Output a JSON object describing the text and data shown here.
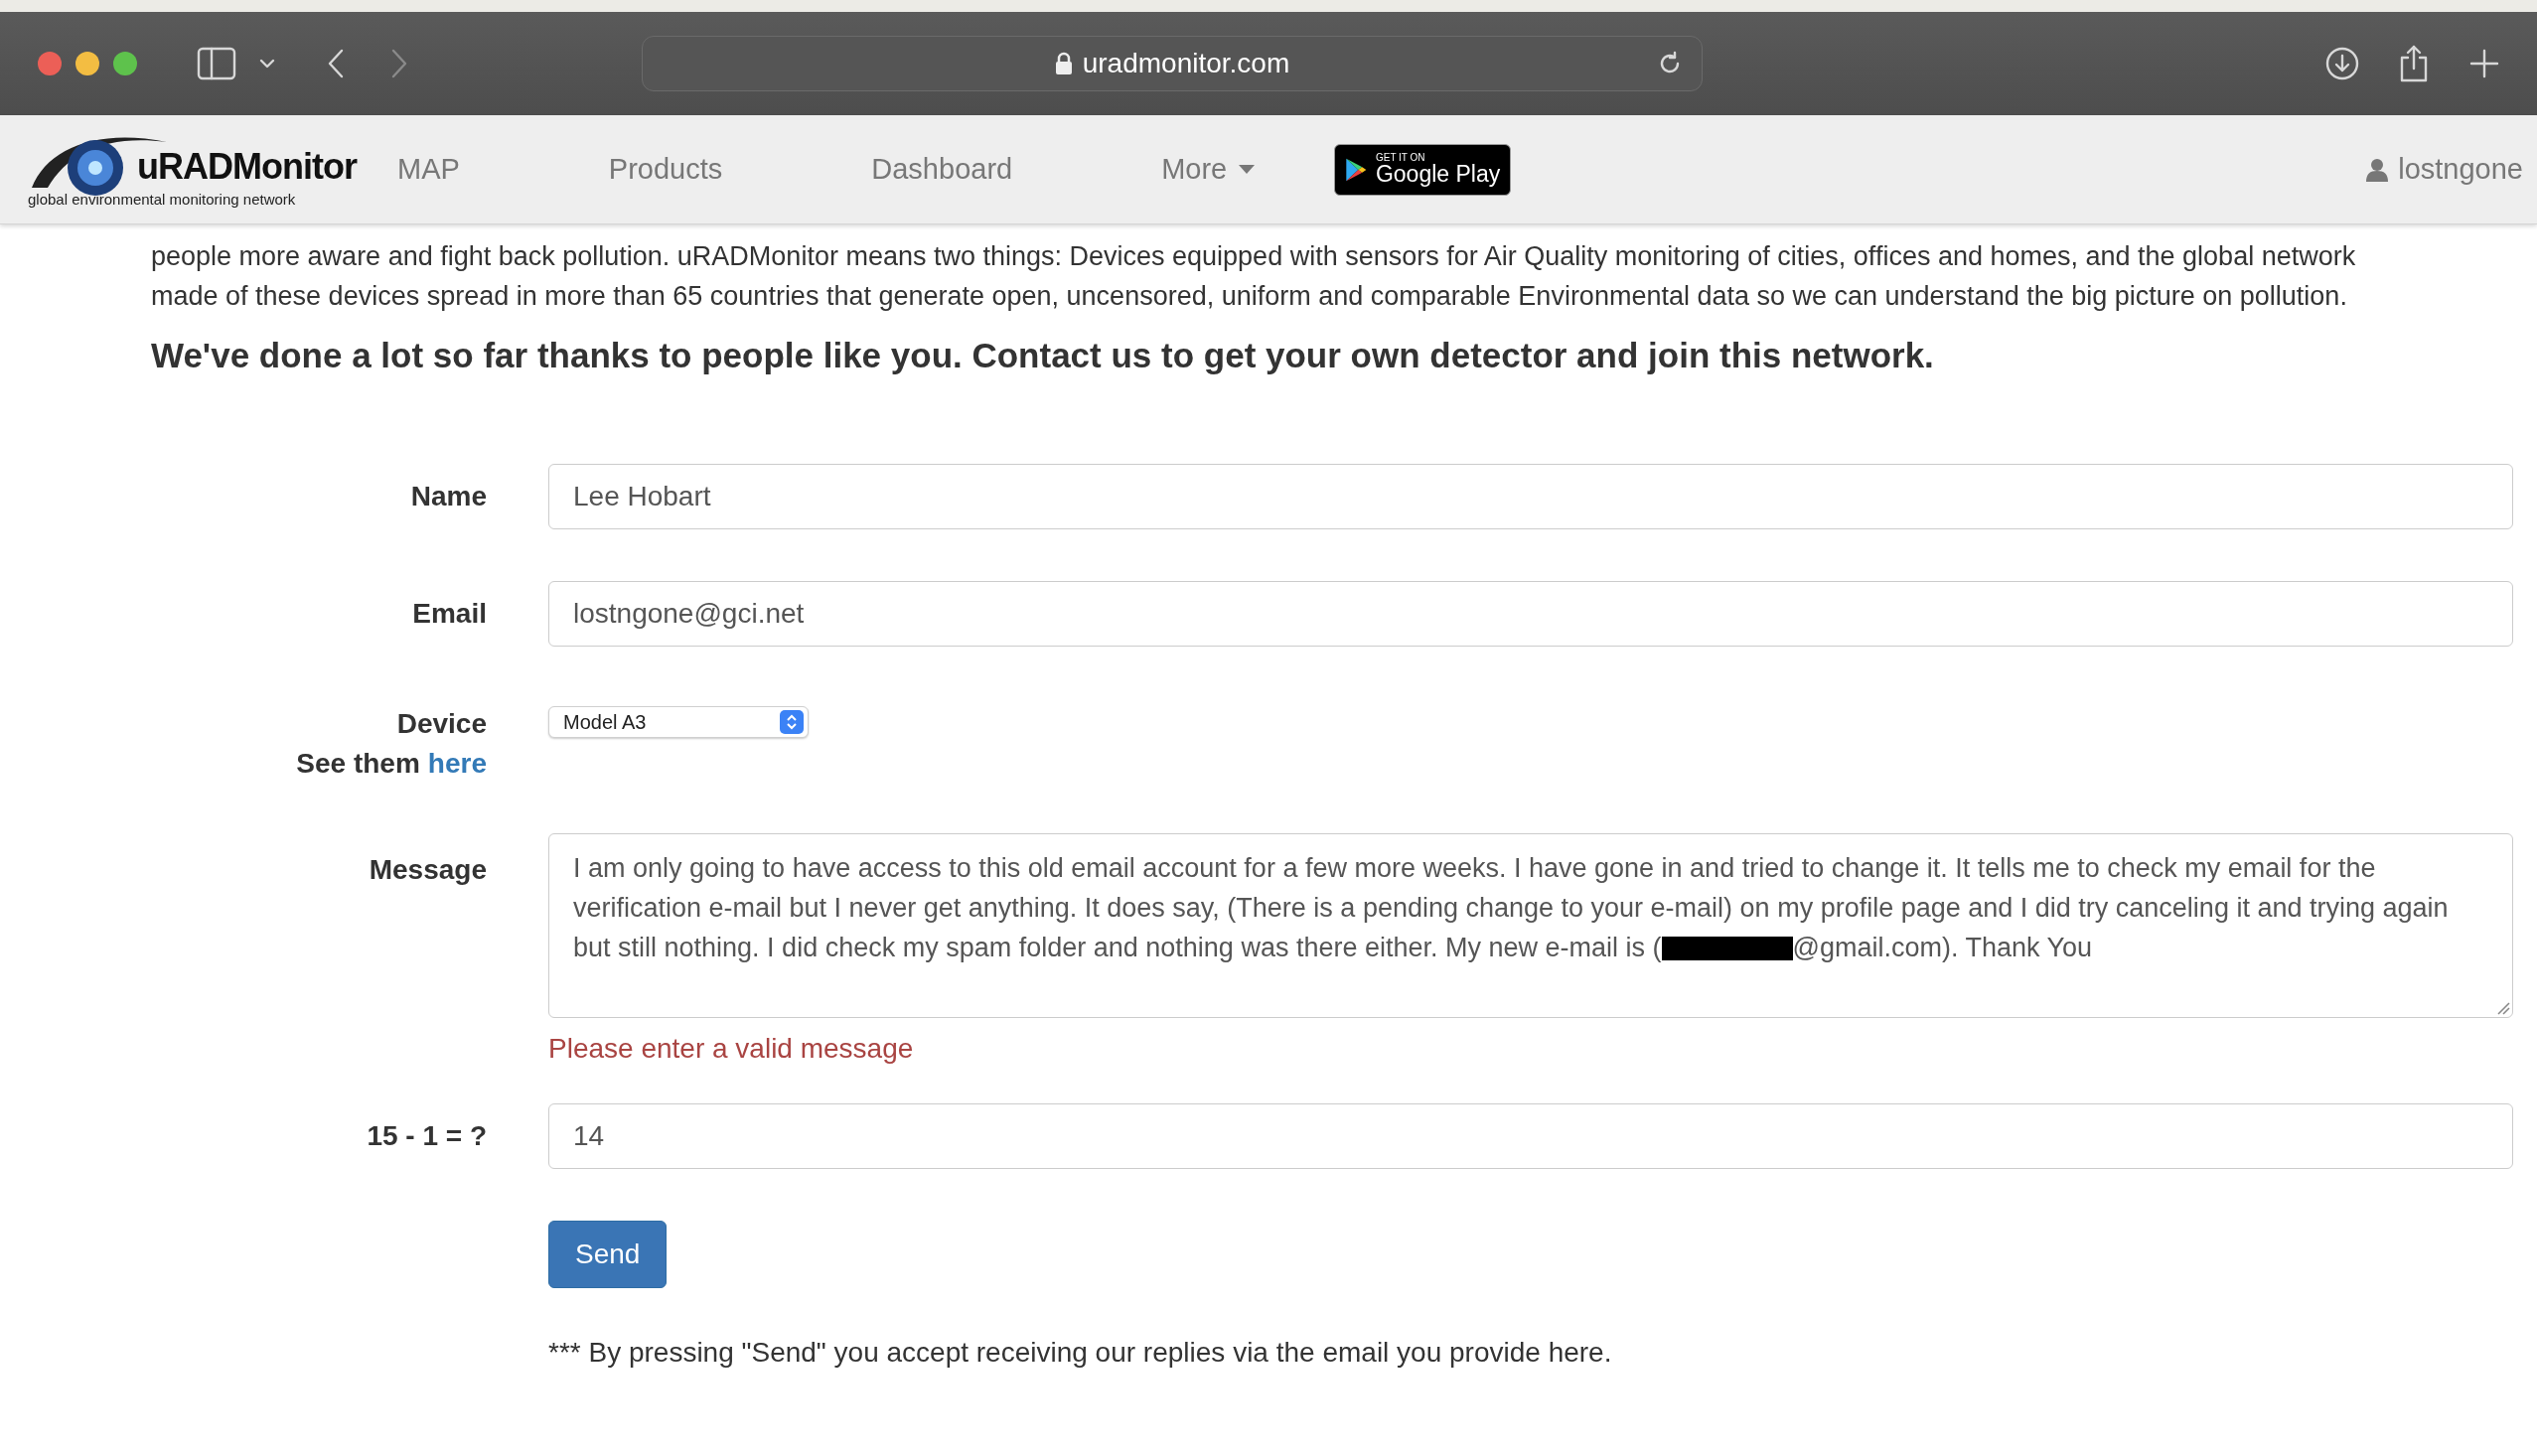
{
  "browser": {
    "url": "uradmonitor.com"
  },
  "nav": {
    "logo_text": "uRADMonitor",
    "logo_tagline": "global environmental monitoring network",
    "items": [
      {
        "label": "MAP",
        "kind": "link"
      },
      {
        "label": "Products",
        "kind": "link"
      },
      {
        "label": "Dashboard",
        "kind": "link"
      },
      {
        "label": "More",
        "kind": "dropdown"
      }
    ],
    "store_badge": {
      "small": "GET IT ON",
      "big": "Google Play"
    },
    "user": "lostngone"
  },
  "intro": "people more aware and fight back pollution. uRADMonitor means two things: Devices equipped with sensors for Air Quality monitoring of cities, offices and homes, and the global network made of these devices spread in more than 65 countries that generate open, uncensored, uniform and comparable Environmental data so we can understand the big picture on pollution.",
  "headline": "We've done a lot so far thanks to people like you. Contact us to get your own detector and join this network.",
  "form": {
    "name": {
      "label": "Name",
      "value": "Lee Hobart"
    },
    "email": {
      "label": "Email",
      "value": "lostngone@gci.net"
    },
    "device": {
      "label": "Device",
      "see_text": "See them",
      "see_link": "here",
      "value": "Model A3"
    },
    "message": {
      "label": "Message",
      "before": "I am only going to have access to this old email account for a few more weeks. I have gone in and tried to change it. It tells me to check my email for the verification e-mail but I never get anything. It does say, (There is a pending change to your e-mail) on my profile page and I did try canceling it and trying again but still nothing. I did check my spam folder and nothing was there either. My new e-mail is (",
      "after": "@gmail.com). Thank You",
      "error": "Please enter a valid message"
    },
    "captcha": {
      "label": "15 - 1 = ?",
      "value": "14"
    },
    "send": "Send",
    "note": "*** By pressing \"Send\" you accept receiving our replies via the email you provide here."
  }
}
